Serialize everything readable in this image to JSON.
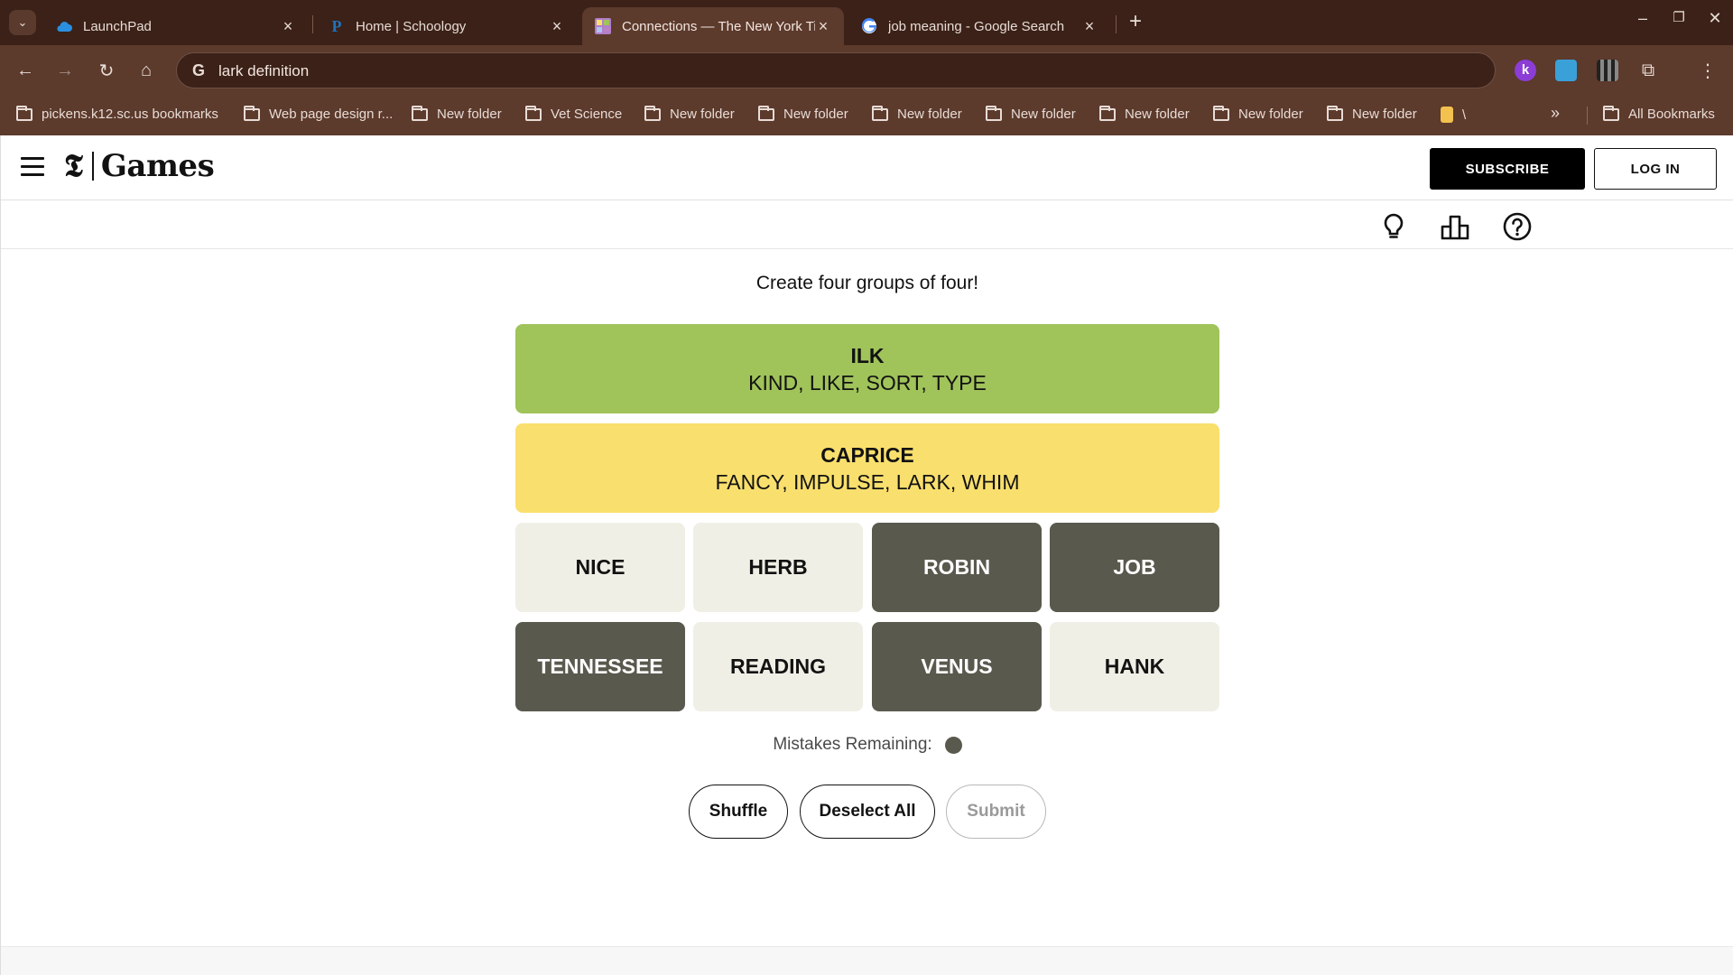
{
  "browser": {
    "tabs": [
      {
        "title": "LaunchPad",
        "favicon": "cloud-icon"
      },
      {
        "title": "Home | Schoology",
        "favicon": "schoology-icon"
      },
      {
        "title": "Connections — The New York Times",
        "favicon": "connections-grid-icon"
      },
      {
        "title": "job meaning - Google Search",
        "favicon": "google-icon"
      }
    ],
    "active_tab_index": 2,
    "address": "lark definition",
    "bookmarks": [
      {
        "label": "pickens.k12.sc.us bookmarks"
      },
      {
        "label": "Web page design r..."
      },
      {
        "label": "New folder"
      },
      {
        "label": "Vet Science"
      },
      {
        "label": "New folder"
      },
      {
        "label": "New folder"
      },
      {
        "label": "New folder"
      },
      {
        "label": "New folder"
      },
      {
        "label": "New folder"
      },
      {
        "label": "New folder"
      },
      {
        "label": "New folder"
      },
      {
        "label": "\\"
      }
    ],
    "more_bookmarks": "»",
    "all_bookmarks": "All Bookmarks"
  },
  "site": {
    "logo_glyph": "𝕿",
    "logo_text": "Games",
    "subscribe": "SUBSCRIBE",
    "login": "LOG IN"
  },
  "game": {
    "prompt": "Create four groups of four!",
    "solved": [
      {
        "name": "ILK",
        "words": "KIND, LIKE, SORT, TYPE",
        "color": "#a0c35a"
      },
      {
        "name": "CAPRICE",
        "words": "FANCY, IMPULSE, LARK, WHIM",
        "color": "#f9df6d"
      }
    ],
    "tiles": [
      {
        "word": "NICE",
        "selected": false
      },
      {
        "word": "HERB",
        "selected": false
      },
      {
        "word": "ROBIN",
        "selected": true
      },
      {
        "word": "JOB",
        "selected": true
      },
      {
        "word": "TENNESSEE",
        "selected": true
      },
      {
        "word": "READING",
        "selected": false
      },
      {
        "word": "VENUS",
        "selected": true
      },
      {
        "word": "HANK",
        "selected": false
      }
    ],
    "mistakes_label": "Mistakes Remaining:",
    "mistakes_remaining": 1,
    "buttons": {
      "shuffle": "Shuffle",
      "deselect": "Deselect All",
      "submit": "Submit"
    }
  },
  "colors": {
    "tab_bar": "#3b2117",
    "toolbar": "#5c3a2c",
    "tile_default": "#efefe6",
    "tile_selected": "#5a594e"
  }
}
